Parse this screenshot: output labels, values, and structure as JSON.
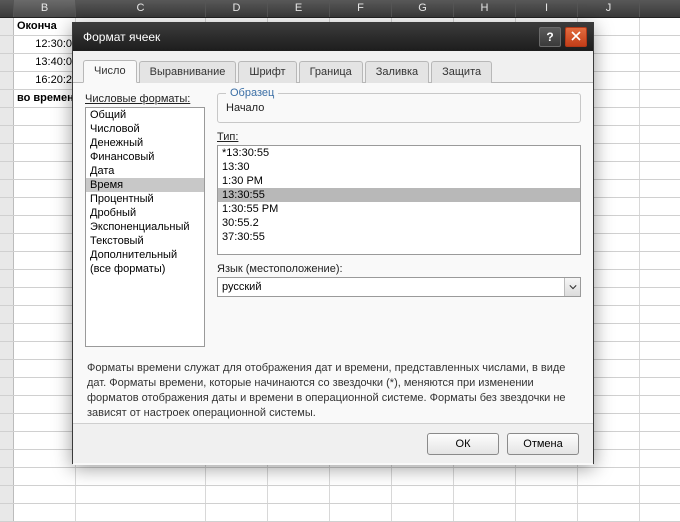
{
  "sheet": {
    "columns": [
      "B",
      "C",
      "D",
      "E",
      "F",
      "G",
      "H",
      "I",
      "J"
    ],
    "header_row": {
      "b": "Оконча",
      "c": ""
    },
    "rows": [
      {
        "b": "12:30:0"
      },
      {
        "b": "13:40:0"
      },
      {
        "b": "16:20:2"
      }
    ],
    "footer_b": "во времени"
  },
  "dialog": {
    "title": "Формат ячеек",
    "tabs": [
      "Число",
      "Выравнивание",
      "Шрифт",
      "Граница",
      "Заливка",
      "Защита"
    ],
    "active_tab": 0,
    "categories_label": "Числовые форматы:",
    "categories": [
      "Общий",
      "Числовой",
      "Денежный",
      "Финансовый",
      "Дата",
      "Время",
      "Процентный",
      "Дробный",
      "Экспоненциальный",
      "Текстовый",
      "Дополнительный",
      "(все форматы)"
    ],
    "category_selected": 5,
    "sample_label": "Образец",
    "sample_value": "Начало",
    "type_label": "Тип:",
    "types": [
      "*13:30:55",
      "13:30",
      "1:30 PM",
      "13:30:55",
      "1:30:55 PM",
      "30:55.2",
      "37:30:55"
    ],
    "type_selected": 3,
    "locale_label": "Язык (местоположение):",
    "locale_value": "русский",
    "description": "Форматы времени служат для отображения дат и времени, представленных числами, в виде дат. Форматы времени, которые начинаются со звездочки (*), меняются при изменении форматов отображения даты и времени в операционной системе. Форматы без звездочки не зависят от настроек операционной системы.",
    "ok": "ОК",
    "cancel": "Отмена"
  }
}
